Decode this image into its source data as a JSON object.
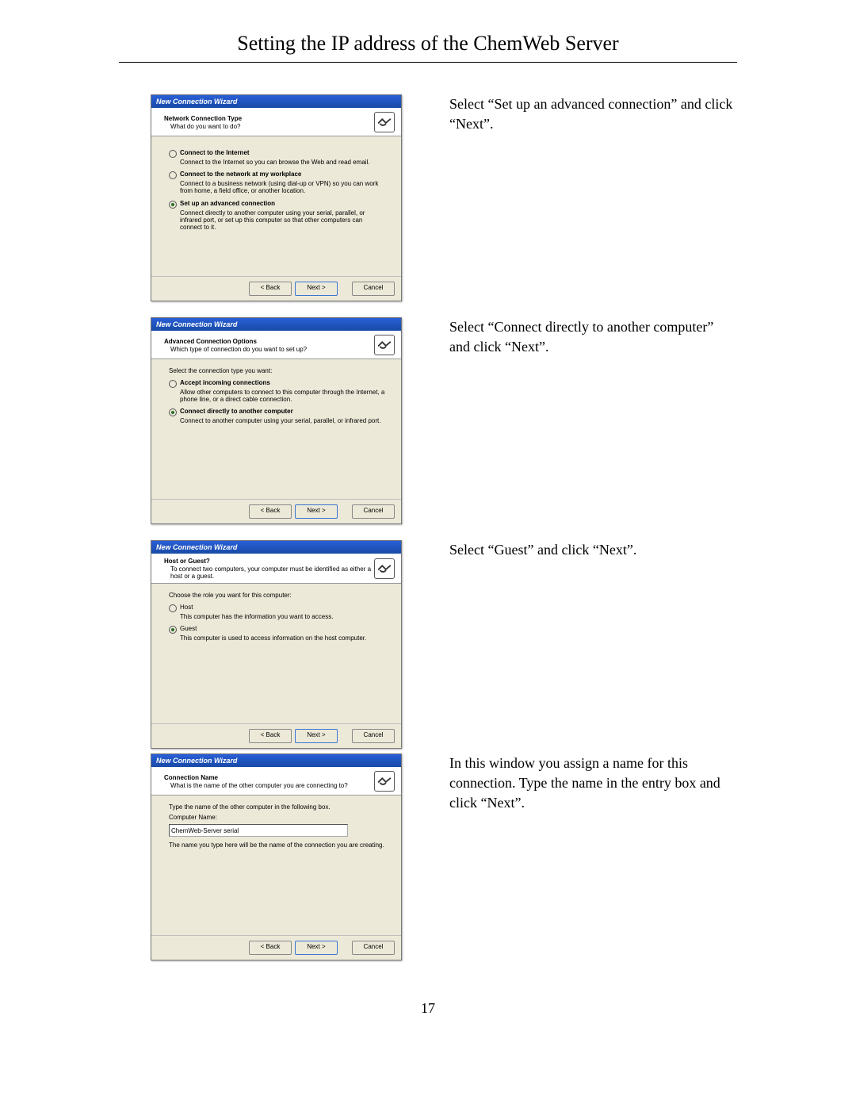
{
  "doc": {
    "title": "Setting the IP address of the ChemWeb Server",
    "page_number": "17"
  },
  "steps": [
    {
      "instruction": "Select “Set up an advanced connection” and click “Next”."
    },
    {
      "instruction": "Select “Connect directly to another computer” and click “Next”."
    },
    {
      "instruction": "Select “Guest” and click “Next”."
    },
    {
      "instruction": "In this window you assign a name for this connection. Type the name in the entry box and click “Next”."
    }
  ],
  "wizard_title": "New Connection Wizard",
  "buttons": {
    "back": "< Back",
    "next": "Next >",
    "cancel": "Cancel"
  },
  "w1": {
    "header_title": "Network Connection Type",
    "header_sub": "What do you want to do?",
    "options": [
      {
        "label": "Connect to the Internet",
        "desc": "Connect to the Internet so you can browse the Web and read email.",
        "selected": false
      },
      {
        "label": "Connect to the network at my workplace",
        "desc": "Connect to a business network (using dial-up or VPN) so you can work from home, a field office, or another location.",
        "selected": false
      },
      {
        "label": "Set up an advanced connection",
        "desc": "Connect directly to another computer using your serial, parallel, or infrared port, or set up this computer so that other computers can connect to it.",
        "selected": true
      }
    ]
  },
  "w2": {
    "header_title": "Advanced Connection Options",
    "header_sub": "Which type of connection do you want to set up?",
    "prompt": "Select the connection type you want:",
    "options": [
      {
        "label": "Accept incoming connections",
        "desc": "Allow other computers to connect to this computer through the Internet, a phone line, or a direct cable connection.",
        "selected": false
      },
      {
        "label": "Connect directly to another computer",
        "desc": "Connect to another computer using your serial, parallel, or infrared port.",
        "selected": true
      }
    ]
  },
  "w3": {
    "header_title": "Host or Guest?",
    "header_sub": "To connect two computers, your computer must be identified as either a host or a guest.",
    "prompt": "Choose the role you want for this computer:",
    "options": [
      {
        "label": "Host",
        "desc": "This computer has the information you want to access.",
        "selected": false
      },
      {
        "label": "Guest",
        "desc": "This computer is used to access information on the host computer.",
        "selected": true
      }
    ]
  },
  "w4": {
    "header_title": "Connection Name",
    "header_sub": "What is the name of the other computer you are connecting to?",
    "prompt": "Type the name of the other computer in the following box.",
    "field_label": "Computer Name:",
    "value": "ChemWeb-Server serial",
    "note": "The name you type here will be the name of the connection you are creating."
  }
}
